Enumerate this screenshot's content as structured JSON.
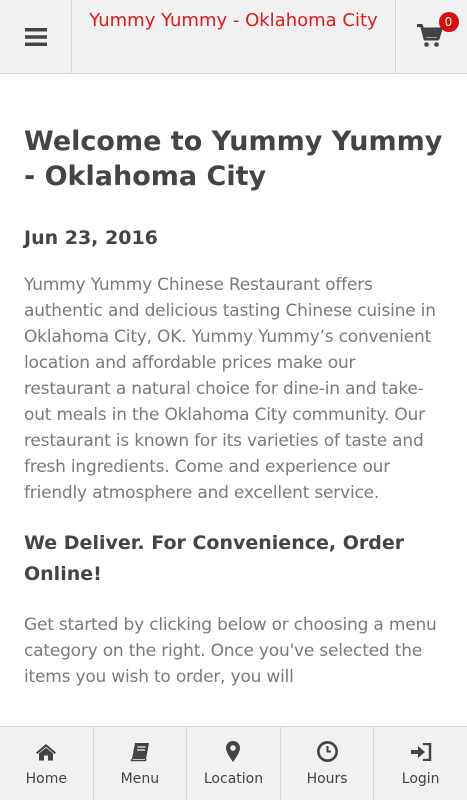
{
  "header": {
    "title": "Yummy Yummy - Oklahoma City",
    "menu_icon": "hamburger-icon",
    "cart_icon": "cart-icon",
    "cart_count": "0"
  },
  "main": {
    "heading": "Welcome to Yummy Yummy - Oklahoma City",
    "date": "Jun 23, 2016",
    "intro": "Yummy Yummy Chinese Restaurant offers authentic and delicious tasting Chinese cuisine in Oklahoma City, OK. Yummy Yummy’s convenient location and affordable prices make our restaurant a natural choice for dine-in and take-out meals in the Oklahoma City community. Our restaurant is known for its varieties of taste and fresh ingredients. Come and experience our friendly atmosphere and excellent service.",
    "subheading": "We Deliver. For Convenience, Order Online!",
    "order_text": "Get started by clicking below or choosing a menu category on the right. Once you've selected the items you wish to order, you will"
  },
  "bottom_nav": {
    "items": [
      {
        "label": "Home",
        "icon": "home-icon"
      },
      {
        "label": "Menu",
        "icon": "book-icon"
      },
      {
        "label": "Location",
        "icon": "map-marker-icon"
      },
      {
        "label": "Hours",
        "icon": "clock-icon"
      },
      {
        "label": "Login",
        "icon": "sign-in-icon"
      }
    ]
  },
  "colors": {
    "title_red": "#e11919",
    "badge_red": "#d90d0d",
    "bar_bg": "#f1f1f1",
    "body_text": "#7a7a7a",
    "heading_text": "#444444"
  }
}
